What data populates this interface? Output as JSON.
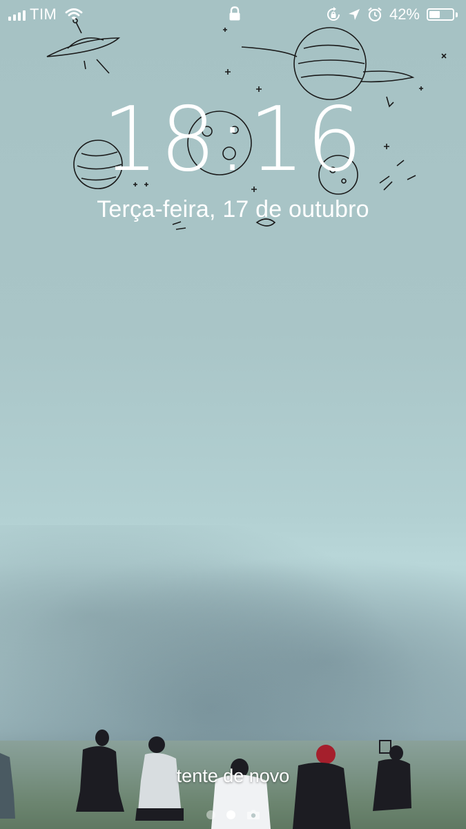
{
  "status_bar": {
    "carrier": "TIM",
    "battery_percent": "42%",
    "battery_level": 0.42
  },
  "lock_screen": {
    "time": "18:16",
    "date": "Terça-feira, 17 de outubro",
    "unlock_message": "tente de novo"
  },
  "pager": {
    "pages": 2,
    "active_index": 1,
    "camera_icon": "camera-icon"
  },
  "icons": [
    "signal-icon",
    "wifi-icon",
    "lock-icon",
    "rotation-lock-icon",
    "location-arrow-icon",
    "alarm-icon",
    "battery-icon"
  ]
}
